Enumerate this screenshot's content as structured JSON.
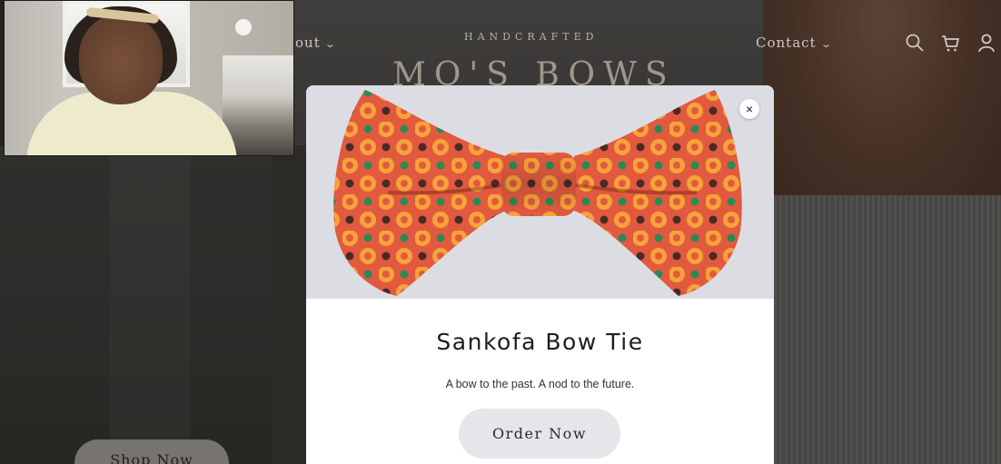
{
  "storefront": {
    "nav_about": "out",
    "tagline": "HANDCRAFTED",
    "brand": "MO'S BOWS",
    "nav_contact": "Contact",
    "icons": [
      "search-icon",
      "cart-icon",
      "account-icon"
    ],
    "shop_now_label": "Shop Now"
  },
  "webcam": {
    "description_icon": "video-call-participant"
  },
  "modal": {
    "title": "Sankofa Bow Tie",
    "subtitle": "A bow to the past. A nod to the future.",
    "order_button": "Order Now",
    "close_label": "×"
  },
  "colors": {
    "bowtie_red": "#e15a3f",
    "dot_orange": "#f7a23a",
    "dot_green": "#2a8a56",
    "dot_brown": "#4a2a25"
  }
}
